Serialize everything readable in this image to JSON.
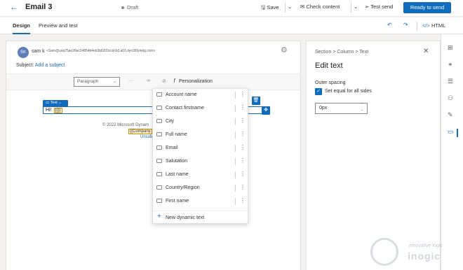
{
  "header": {
    "back_icon": "back-arrow-icon",
    "title": "Email 3",
    "status": "Draft",
    "save": "Save",
    "check_content": "Check content",
    "test_send": "Test send",
    "ready_to_send": "Ready to send"
  },
  "tabs": {
    "design": "Design",
    "preview": "Preview and test",
    "html": "HTML"
  },
  "email": {
    "avatar_initials": "SK",
    "sender_name": "sam k",
    "sender_email": "<Sam@unq75ae28ac24854b4eb3b6203ccdcb3.a03.dyn365mktg.com>",
    "subject_label": "Subject:",
    "subject_link": "Add a subject"
  },
  "toolbar": {
    "format": "Paragraph",
    "personalization": "Personalization"
  },
  "canvas": {
    "text_chip": "Text",
    "hi_text": "Hi!",
    "token": "{{}}",
    "footer_copyright": "© 2022 Microsoft Dynam",
    "footer_company": "{{Company",
    "footer_unsub": "Unsubs"
  },
  "dropdown": {
    "items": [
      "Account name",
      "Contact firstname",
      "City",
      "Full name",
      "Email",
      "Salutation",
      "Last name",
      "Country/Region",
      "First name"
    ],
    "new_item": "New dynamic text"
  },
  "panel": {
    "breadcrumb": "Section  >  Column  >  Text",
    "title": "Edit text",
    "outer_spacing": "Outer spacing",
    "checkbox_label": "Set equal for all sides",
    "checkbox_checked": true,
    "spacing_value": "0px"
  },
  "watermark": {
    "line1": "innovative logic",
    "line2": "inogic"
  },
  "colors": {
    "accent": "#0f6cbd",
    "token_bg": "#fff4ce"
  }
}
